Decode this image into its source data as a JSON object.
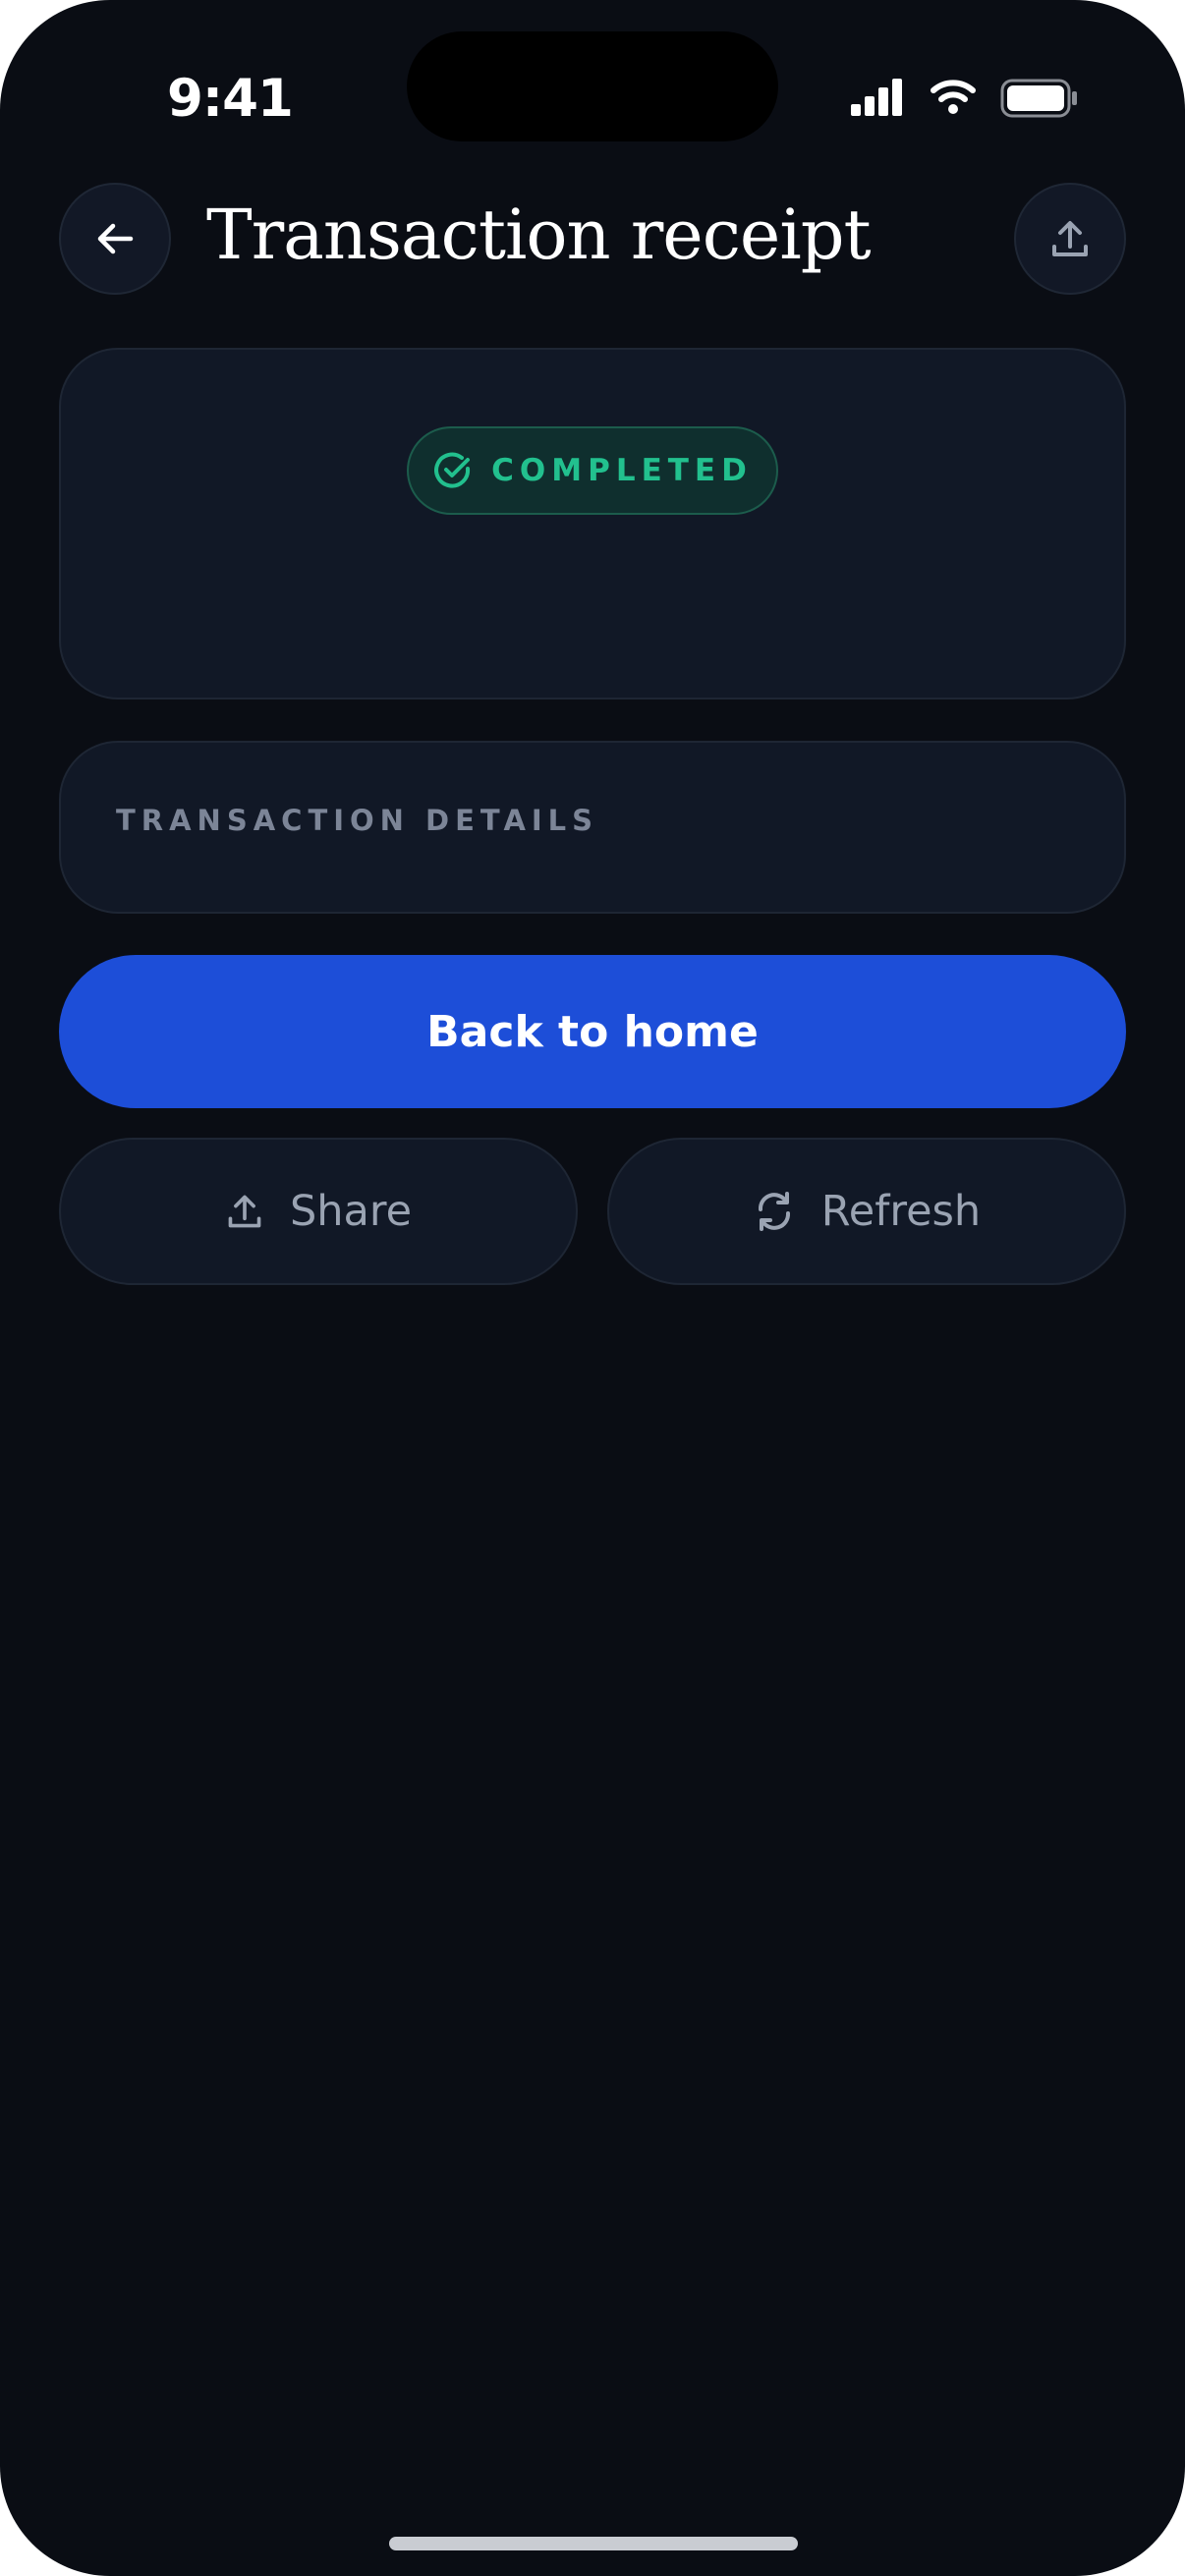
{
  "status_bar": {
    "time": "9:41"
  },
  "header": {
    "title": "Transaction receipt"
  },
  "status_card": {
    "badge": "COMPLETED",
    "badge_color": "#22c08e"
  },
  "details_card": {
    "section_label": "TRANSACTION DETAILS"
  },
  "actions": {
    "primary": "Back to home",
    "share": "Share",
    "refresh": "Refresh"
  },
  "colors": {
    "background": "#0a0d14",
    "card": "#111826",
    "accent": "#1d4ed8",
    "success": "#22c08e"
  },
  "icons": [
    "back-arrow-icon",
    "upload-icon",
    "check-circle-icon",
    "refresh-icon"
  ]
}
